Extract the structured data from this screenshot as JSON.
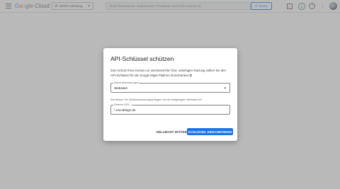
{
  "header": {
    "logo_text": "Google Cloud",
    "project_label": "MAPS Anleitung",
    "search_placeholder": "Nach Ressourcen, Dokumenten, Produkten und mehr suchen (/)",
    "search_button_label": "Suche",
    "notification_count": "8"
  },
  "dialog": {
    "title": "API-Schlüssel schützen",
    "description": "Zum Schutz Ihres Kontos vor unerwünschter bzw. unbefugter Nutzung sollten Sie den API-Schlüssel für die Google Maps Platform einschränken",
    "restriction_type": {
      "label": "Select restriction type",
      "value": "Websites"
    },
    "hint": "Schränken Sie Schlüsselnutzungsanfragen auf die festgelegten Websites ein",
    "referrer": {
      "label": "Referrer-URL *",
      "value": "*.encoblogz.de"
    },
    "later_button": "VIELLEICHT SPÄTER",
    "restrict_button": "SCHLÜSSEL EINSCHRÄNKEN"
  },
  "colors": {
    "primary": "#1a73e8",
    "overlay": "#808080",
    "status_green": "#34a853"
  }
}
